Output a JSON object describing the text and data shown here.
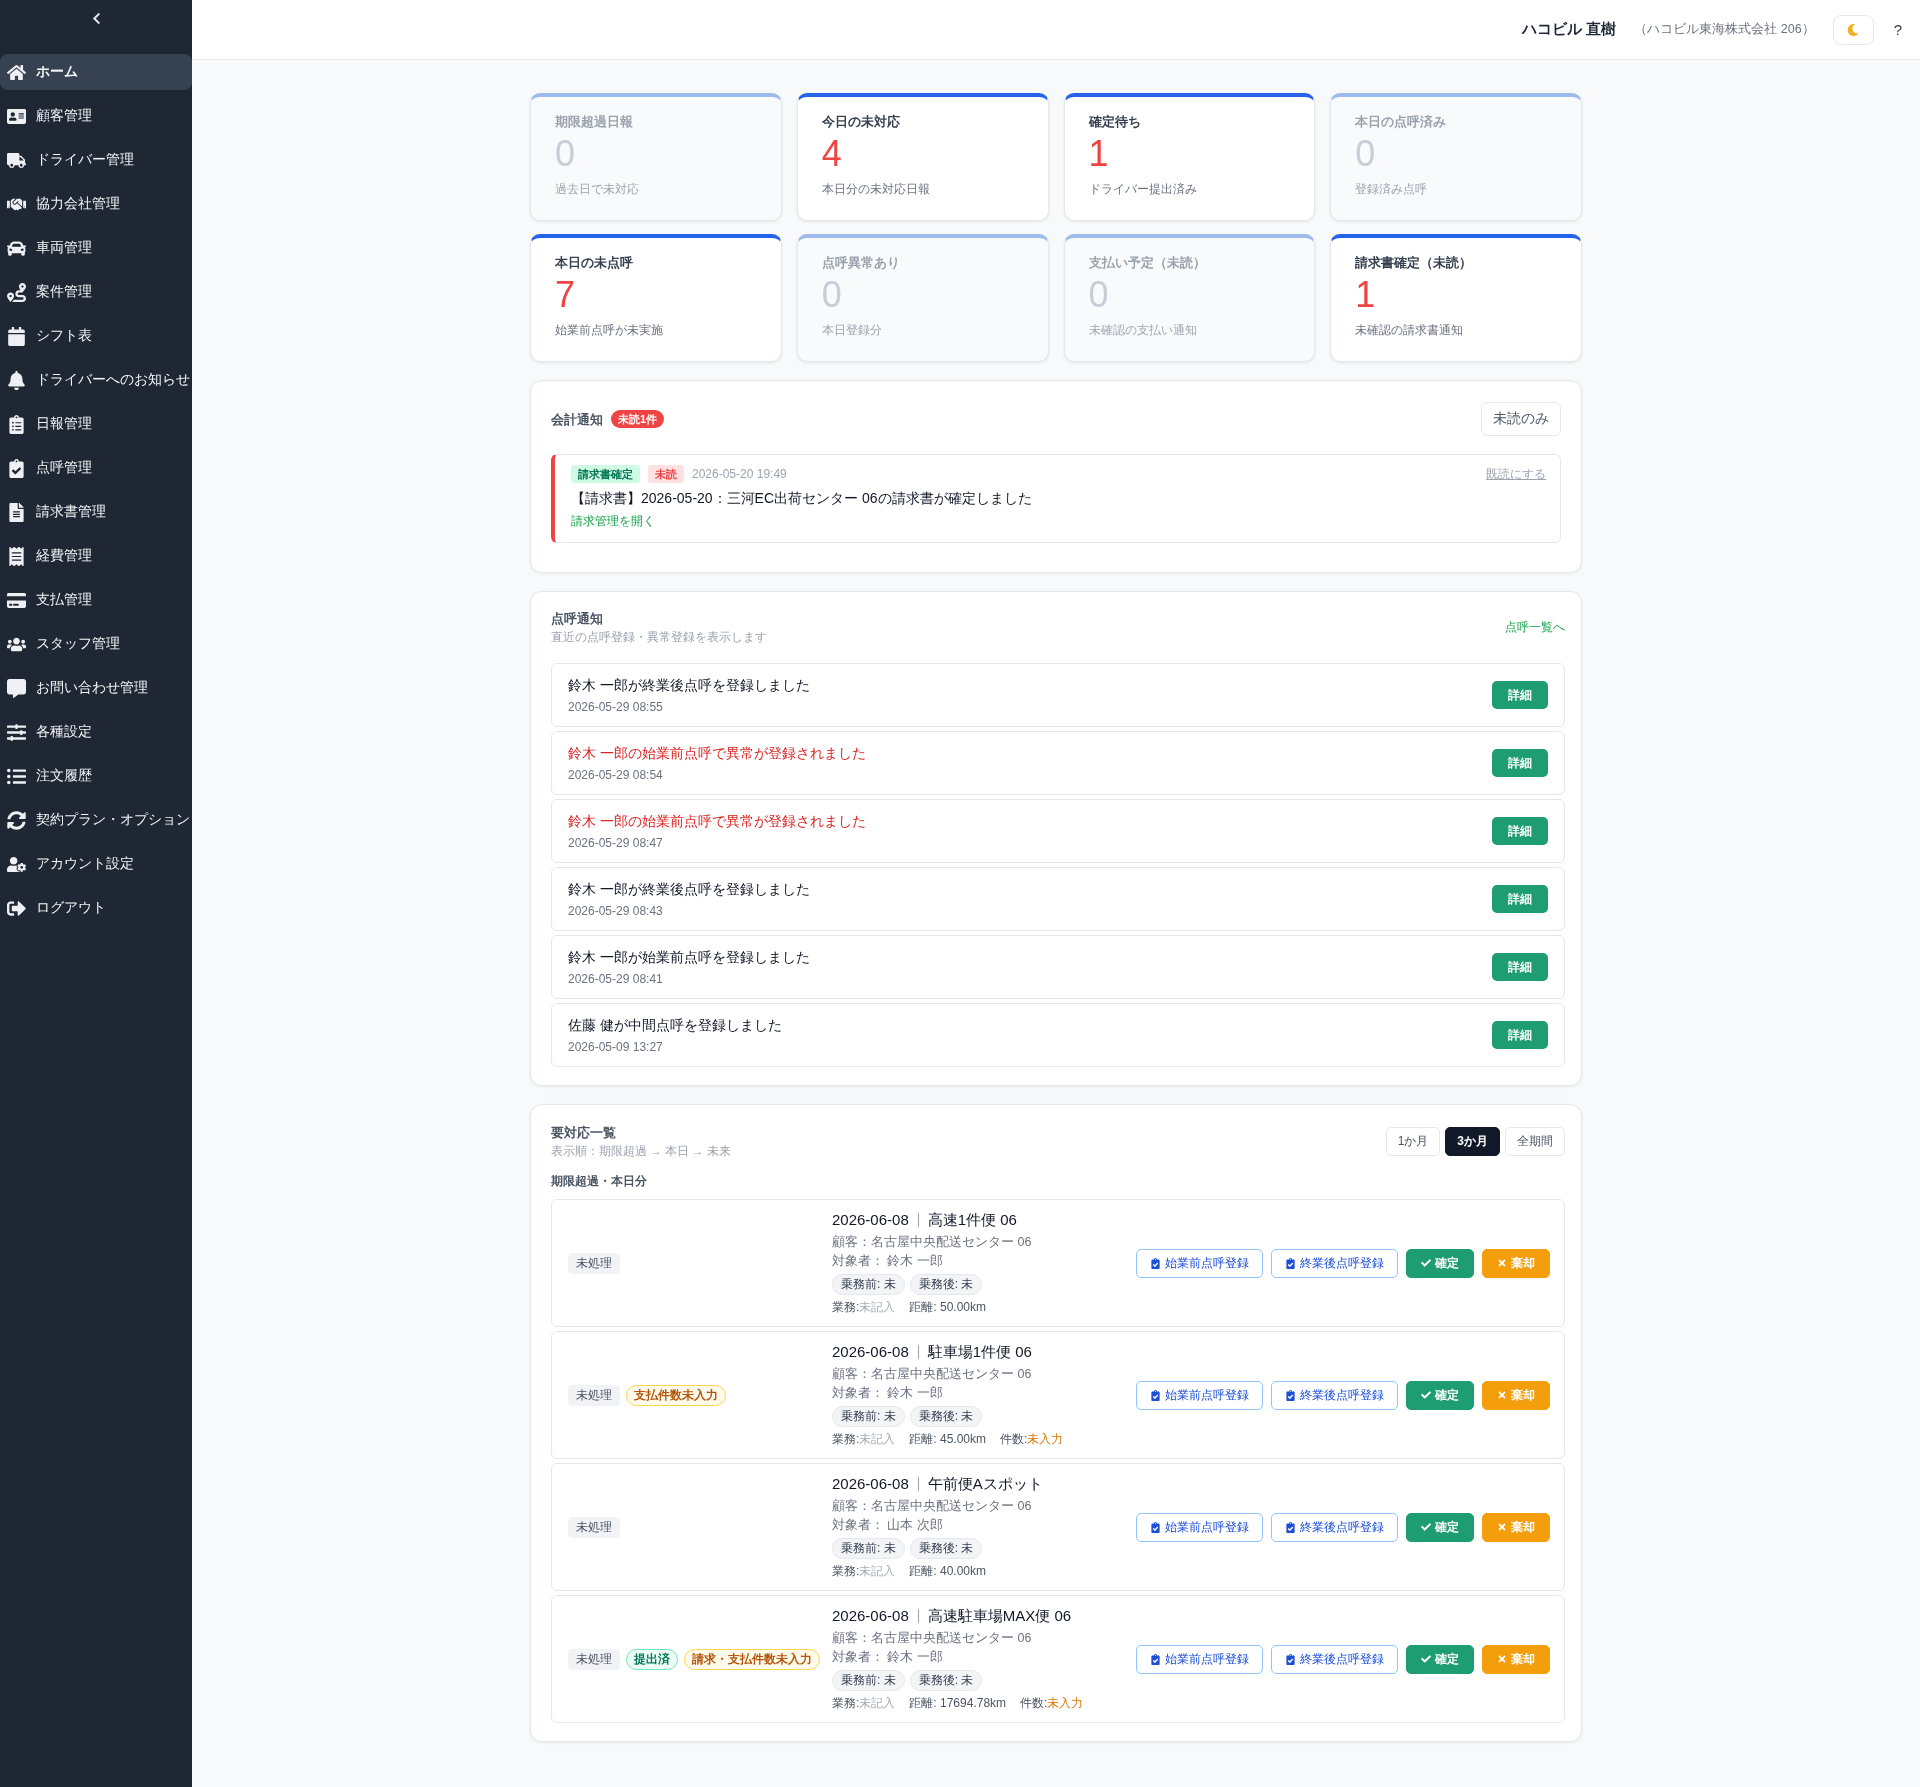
{
  "sidebar": {
    "items": [
      {
        "label": "ホーム",
        "selected": true
      },
      {
        "label": "顧客管理",
        "selected": false
      },
      {
        "label": "ドライバー管理",
        "selected": false
      },
      {
        "label": "協力会社管理",
        "selected": false
      },
      {
        "label": "車両管理",
        "selected": false
      },
      {
        "label": "案件管理",
        "selected": false
      },
      {
        "label": "シフト表",
        "selected": false
      },
      {
        "label": "ドライバーへのお知らせ",
        "selected": false
      },
      {
        "label": "日報管理",
        "selected": false
      },
      {
        "label": "点呼管理",
        "selected": false
      },
      {
        "label": "請求書管理",
        "selected": false
      },
      {
        "label": "経費管理",
        "selected": false
      },
      {
        "label": "支払管理",
        "selected": false
      },
      {
        "label": "スタッフ管理",
        "selected": false
      },
      {
        "label": "お問い合わせ管理",
        "selected": false
      },
      {
        "label": "各種設定",
        "selected": false
      },
      {
        "label": "注文履歴",
        "selected": false
      },
      {
        "label": "契約プラン・オプション",
        "selected": false
      },
      {
        "label": "アカウント設定",
        "selected": false
      },
      {
        "label": "ログアウト",
        "selected": false
      }
    ]
  },
  "header": {
    "user_name": "ハコビル 直樹",
    "company": "（ハコビル東海株式会社 206）",
    "help": "?"
  },
  "stats": [
    {
      "title": "期限超過日報",
      "value": "0",
      "caption": "過去日で未対応",
      "dimmed": true
    },
    {
      "title": "今日の未対応",
      "value": "4",
      "caption": "本日分の未対応日報",
      "dimmed": false
    },
    {
      "title": "確定待ち",
      "value": "1",
      "caption": "ドライバー提出済み",
      "dimmed": false
    },
    {
      "title": "本日の点呼済み",
      "value": "0",
      "caption": "登録済み点呼",
      "dimmed": true
    },
    {
      "title": "本日の未点呼",
      "value": "7",
      "caption": "始業前点呼が未実施",
      "dimmed": false
    },
    {
      "title": "点呼異常あり",
      "value": "0",
      "caption": "本日登録分",
      "dimmed": true
    },
    {
      "title": "支払い予定（未読）",
      "value": "0",
      "caption": "未確認の支払い通知",
      "dimmed": true
    },
    {
      "title": "請求書確定（未読）",
      "value": "1",
      "caption": "未確認の請求書通知",
      "dimmed": false
    }
  ],
  "accounting": {
    "title": "会計通知",
    "badge": "未読1件",
    "filter_button": "未読のみ",
    "items": [
      {
        "tags": [
          {
            "label": "請求書確定",
            "kind": "category"
          },
          {
            "label": "未読",
            "kind": "unread"
          }
        ],
        "time": "2026-05-20 19:49",
        "mark_read": "既読にする",
        "message": "【請求書】2026-05-20：三河EC出荷センター 06の請求書が確定しました",
        "link": "請求管理を開く",
        "unread": true
      }
    ]
  },
  "roll_call": {
    "title": "点呼通知",
    "subtitle": "直近の点呼登録・異常登録を表示します",
    "link": "点呼一覧へ",
    "items": [
      {
        "message": "鈴木 一郎が終業後点呼を登録しました",
        "time": "2026-05-29 08:55",
        "alert": false,
        "button": "詳細"
      },
      {
        "message": "鈴木 一郎の始業前点呼で異常が登録されました",
        "time": "2026-05-29 08:54",
        "alert": true,
        "button": "詳細"
      },
      {
        "message": "鈴木 一郎の始業前点呼で異常が登録されました",
        "time": "2026-05-29 08:47",
        "alert": true,
        "button": "詳細"
      },
      {
        "message": "鈴木 一郎が終業後点呼を登録しました",
        "time": "2026-05-29 08:43",
        "alert": false,
        "button": "詳細"
      },
      {
        "message": "鈴木 一郎が始業前点呼を登録しました",
        "time": "2026-05-29 08:41",
        "alert": false,
        "button": "詳細"
      },
      {
        "message": "佐藤 健が中間点呼を登録しました",
        "time": "2026-05-09 13:27",
        "alert": false,
        "button": "詳細"
      }
    ]
  },
  "tasks": {
    "title": "要対応一覧",
    "subtitle": "表示順：期限超過 → 本日 → 未来",
    "periods": [
      {
        "label": "1か月",
        "selected": false
      },
      {
        "label": "3か月",
        "selected": true
      },
      {
        "label": "全期間",
        "selected": false
      }
    ],
    "section": "期限超過・本日分",
    "rows": [
      {
        "badges": [
          {
            "label": "未処理",
            "kind": "neutral"
          }
        ],
        "date": "2026-06-08",
        "name": "高速1件便 06",
        "customer": "顧客：名古屋中央配送センター 06",
        "assignee": "対象者： 鈴木 一郎",
        "checks": [
          "乗務前: 未",
          "乗務後: 未"
        ],
        "meta": [
          {
            "label": "業務:",
            "value": "未記入",
            "kind": "muted"
          },
          {
            "label": "距離: 50.00km",
            "kind": "plain"
          }
        ],
        "buttons": [
          {
            "label": "始業前点呼登録",
            "kind": "register"
          },
          {
            "label": "終業後点呼登録",
            "kind": "register"
          },
          {
            "label": "確定",
            "kind": "confirm"
          },
          {
            "label": "棄却",
            "kind": "reject"
          }
        ]
      },
      {
        "badges": [
          {
            "label": "未処理",
            "kind": "neutral"
          },
          {
            "label": "支払件数未入力",
            "kind": "warning"
          }
        ],
        "date": "2026-06-08",
        "name": "駐車場1件便 06",
        "customer": "顧客：名古屋中央配送センター 06",
        "assignee": "対象者： 鈴木 一郎",
        "checks": [
          "乗務前: 未",
          "乗務後: 未"
        ],
        "meta": [
          {
            "label": "業務:",
            "value": "未記入",
            "kind": "muted"
          },
          {
            "label": "距離: 45.00km",
            "kind": "plain"
          },
          {
            "label": "件数:",
            "value": "未入力",
            "kind": "warning"
          }
        ],
        "buttons": [
          {
            "label": "始業前点呼登録",
            "kind": "register"
          },
          {
            "label": "終業後点呼登録",
            "kind": "register"
          },
          {
            "label": "確定",
            "kind": "confirm"
          },
          {
            "label": "棄却",
            "kind": "reject"
          }
        ]
      },
      {
        "badges": [
          {
            "label": "未処理",
            "kind": "neutral"
          }
        ],
        "date": "2026-06-08",
        "name": "午前便Aスポット",
        "customer": "顧客：名古屋中央配送センター 06",
        "assignee": "対象者： 山本 次郎",
        "checks": [
          "乗務前: 未",
          "乗務後: 未"
        ],
        "meta": [
          {
            "label": "業務:",
            "value": "未記入",
            "kind": "muted"
          },
          {
            "label": "距離: 40.00km",
            "kind": "plain"
          }
        ],
        "buttons": [
          {
            "label": "始業前点呼登録",
            "kind": "register"
          },
          {
            "label": "終業後点呼登録",
            "kind": "register"
          },
          {
            "label": "確定",
            "kind": "confirm"
          },
          {
            "label": "棄却",
            "kind": "reject"
          }
        ]
      },
      {
        "badges": [
          {
            "label": "未処理",
            "kind": "neutral"
          },
          {
            "label": "提出済",
            "kind": "success"
          },
          {
            "label": "請求・支払件数未入力",
            "kind": "warning"
          }
        ],
        "date": "2026-06-08",
        "name": "高速駐車場MAX便 06",
        "customer": "顧客：名古屋中央配送センター 06",
        "assignee": "対象者： 鈴木 一郎",
        "checks": [
          "乗務前: 未",
          "乗務後: 未"
        ],
        "meta": [
          {
            "label": "業務:",
            "value": "未記入",
            "kind": "muted"
          },
          {
            "label": "距離: 17694.78km",
            "kind": "plain"
          },
          {
            "label": "件数:",
            "value": "未入力",
            "kind": "warning"
          }
        ],
        "buttons": [
          {
            "label": "始業前点呼登録",
            "kind": "register"
          },
          {
            "label": "終業後点呼登録",
            "kind": "register"
          },
          {
            "label": "確定",
            "kind": "confirm"
          },
          {
            "label": "棄却",
            "kind": "reject"
          }
        ]
      }
    ]
  }
}
